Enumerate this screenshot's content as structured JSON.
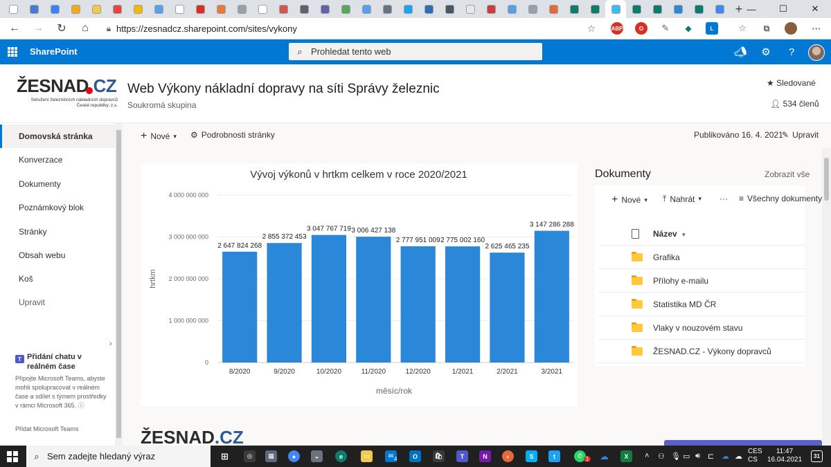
{
  "browser": {
    "tab_favicon_colors": [
      "#ffffff",
      "#4a7bd1",
      "#3b82f6",
      "#f4a720",
      "#f2c94c",
      "#e8453c",
      "#f5b800",
      "#5aa0e8",
      "#ffffff",
      "#d93025",
      "#e87a3b",
      "#9aa0a6",
      "#ffffff",
      "#d9534f",
      "#5f6368",
      "#6264a7",
      "#58a55c",
      "#5aa0e8",
      "#6b7280",
      "#1da1f2",
      "#2f6db5",
      "#4b5563",
      "#e5e7eb",
      "#cc3e3e",
      "#5aa0e8",
      "#9aa0a6",
      "#e8683b",
      "#0f7b6c",
      "#0f7b6c",
      "#38bdf8",
      "#0f7b6c",
      "#0f7b6c",
      "#2b88d8",
      "#0f7b6c",
      "#4285f4"
    ],
    "url": "https://zesnadcz.sharepoint.com/sites/vykony",
    "new_tab_symbol": "+",
    "window_controls": {
      "minimize": "—",
      "maximize": "☐",
      "close": "✕"
    }
  },
  "suite": {
    "brand": "SharePoint",
    "search_placeholder": "Prohledat tento web"
  },
  "site": {
    "logo_text": "ŽESNAD",
    "logo_suffix": ".CZ",
    "logo_tagline_1": "Sdružení železničních nákladních dopravců",
    "logo_tagline_2": "České republiky, z.s.",
    "title": "Web Výkony nákladní dopravy na síti Správy železnic",
    "subtitle": "Soukromá skupina",
    "follow_label": "Sledované",
    "members_label": "534 členů"
  },
  "nav": {
    "items": [
      {
        "label": "Domovská stránka"
      },
      {
        "label": "Konverzace"
      },
      {
        "label": "Dokumenty"
      },
      {
        "label": "Poznámkový blok"
      },
      {
        "label": "Stránky"
      },
      {
        "label": "Obsah webu"
      },
      {
        "label": "Koš"
      },
      {
        "label": "Upravit"
      }
    ],
    "teams_title": "Přidání chatu v reálném čase",
    "teams_text": "Připojte Microsoft Teams, abyste mohli spolupracovat v reálném čase a sdílet s týmem prostředky v rámci Microsoft 365.",
    "teams_link": "Přidat Microsoft Teams"
  },
  "commands": {
    "new_label": "Nové",
    "details_label": "Podrobnosti stránky",
    "published_label": "Publikováno 16. 4. 2021",
    "edit_label": "Upravit"
  },
  "chart_data": {
    "type": "bar",
    "title": "Vývoj výkonů v hrtkm celkem v roce 2020/2021",
    "xlabel": "měsíc/rok",
    "ylabel": "hrtkm",
    "ylim": [
      0,
      4000000000
    ],
    "yticks": [
      "0",
      "1 000 000 000",
      "2 000 000 000",
      "3 000 000 000",
      "4 000 000 000"
    ],
    "categories": [
      "8/2020",
      "9/2020",
      "10/2020",
      "11/2020",
      "12/2020",
      "1/2021",
      "2/2021",
      "3/2021"
    ],
    "values": [
      2647824268,
      2855372453,
      3047767719,
      3006427138,
      2777951009,
      2775002160,
      2625465235,
      3147286288
    ],
    "value_labels": [
      "2 647 824 268",
      "2 855 372 453",
      "3 047 767 719",
      "3 006 427 138",
      "2 777 951 009",
      "2 775 002 160",
      "2 625 465 235",
      "3 147 286 288"
    ],
    "bar_color": "#2b88d8",
    "grid": true,
    "legend": "none"
  },
  "documents": {
    "title": "Dokumenty",
    "show_all": "Zobrazit vše",
    "new_label": "Nové",
    "upload_label": "Nahrát",
    "more_label": "···",
    "view_label": "Všechny dokumenty",
    "column_name": "Název",
    "rows": [
      {
        "name": "Grafika"
      },
      {
        "name": "Přílohy e-mailu"
      },
      {
        "name": "Statistika MD ČR"
      },
      {
        "name": "Vlaky v nouzovém stavu"
      },
      {
        "name": "ŽESNAD.CZ - Výkony dopravců"
      }
    ]
  },
  "taskbar": {
    "search_placeholder": "Sem zadejte hledaný výraz",
    "lang_1": "CES",
    "lang_2": "CS",
    "time": "11:47",
    "date": "16.04.2021",
    "notification_count": "31",
    "mail_badge": "4",
    "whatsapp_badge": "1"
  }
}
